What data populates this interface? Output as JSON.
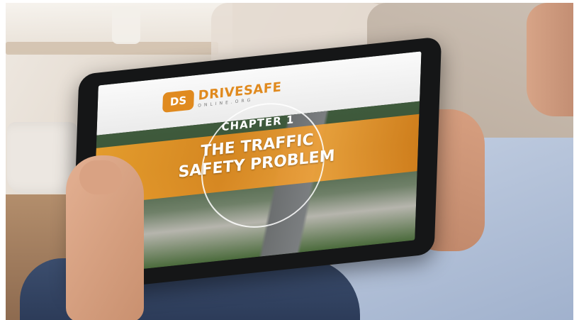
{
  "logo": {
    "mark": "DS",
    "name": "DRIVESAFE",
    "subtitle": "ONLINE.ORG"
  },
  "screen": {
    "chapter": "CHAPTER 1",
    "title_line1": "THE TRAFFIC",
    "title_line2": "SAFETY PROBLEM"
  },
  "colors": {
    "brand_orange": "#e08a1f",
    "tablet_frame": "#151617",
    "shirt": "#9fb0cc"
  }
}
